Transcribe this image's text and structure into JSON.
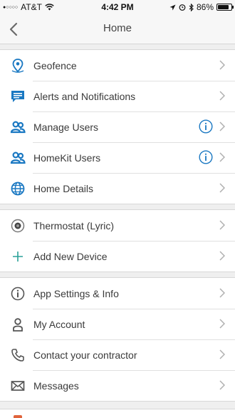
{
  "status_bar": {
    "signal_dots": "●○○○○",
    "carrier": "AT&T",
    "time": "4:42 PM",
    "battery": "86%",
    "battery_level": 0.86
  },
  "header": {
    "title": "Home",
    "back_icon": "chevron-left-icon"
  },
  "sections": [
    {
      "items": [
        {
          "label": "Geofence",
          "icon": "location-pin-icon",
          "info": false
        },
        {
          "label": "Alerts and Notifications",
          "icon": "chat-bubble-icon",
          "info": false
        },
        {
          "label": "Manage Users",
          "icon": "users-icon",
          "info": true
        },
        {
          "label": "HomeKit Users",
          "icon": "users-icon",
          "info": true
        },
        {
          "label": "Home Details",
          "icon": "globe-icon",
          "info": false
        }
      ]
    },
    {
      "items": [
        {
          "label": "Thermostat (Lyric)",
          "icon": "thermostat-icon",
          "info": false
        },
        {
          "label": "Add New Device",
          "icon": "plus-icon",
          "info": false
        }
      ]
    },
    {
      "items": [
        {
          "label": "App Settings & Info",
          "icon": "info-circle-icon",
          "info": false
        },
        {
          "label": "My Account",
          "icon": "person-icon",
          "info": false
        },
        {
          "label": "Contact your contractor",
          "icon": "phone-icon",
          "info": false
        },
        {
          "label": "Messages",
          "icon": "envelope-icon",
          "info": false
        }
      ]
    }
  ],
  "colors": {
    "accent_blue": "#1a78c2",
    "teal": "#2aa198",
    "icon_gray": "#555555",
    "chevron": "#b0b0b0"
  }
}
